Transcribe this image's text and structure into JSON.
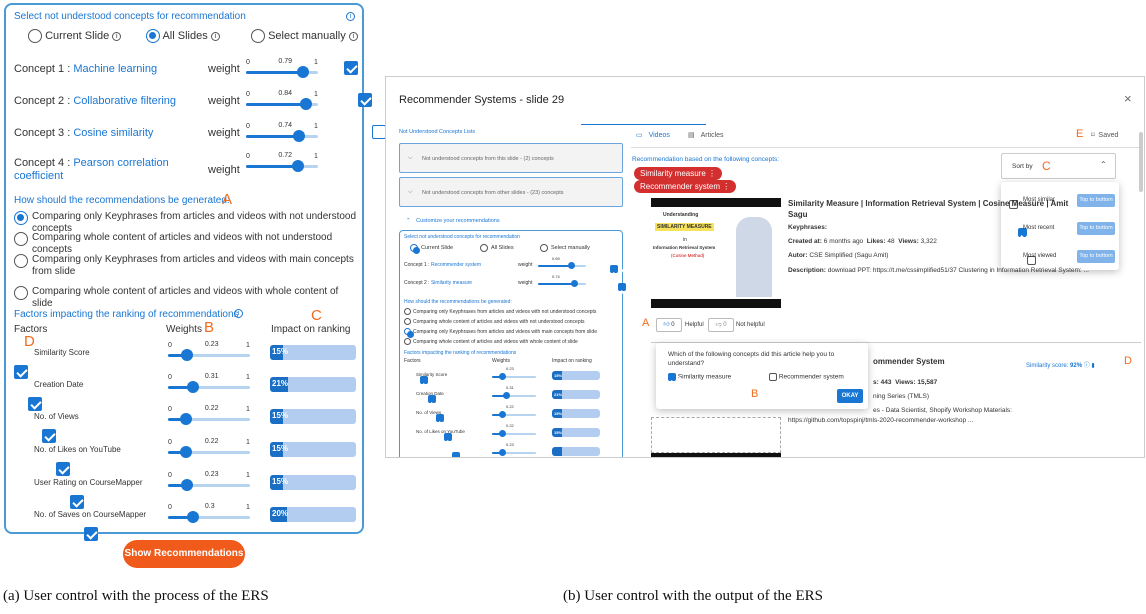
{
  "panelA": {
    "concept_heading": "Select not understood concepts for recommendation",
    "scope_options": [
      "Current Slide",
      "All Slides",
      "Select manually"
    ],
    "scope_selected": 1,
    "weight_label": "weight",
    "concepts": [
      {
        "prefix": "Concept 1 : ",
        "name": "Machine learning",
        "weight": "0.79",
        "value": 0.79,
        "checked": true
      },
      {
        "prefix": "Concept 2 : ",
        "name": "Collaborative filtering",
        "weight": "0.84",
        "value": 0.84,
        "checked": true
      },
      {
        "prefix": "Concept 3 : ",
        "name": "Cosine similarity",
        "weight": "0.74",
        "value": 0.74,
        "checked": false
      },
      {
        "prefix": "Concept 4 : ",
        "name": "Pearson correlation coefficient",
        "weight": "0.72",
        "value": 0.72,
        "checked": true
      }
    ],
    "range_min": "0",
    "range_max": "1",
    "generation_heading": "How should the recommendations be generated:",
    "generation_options": [
      "Comparing only Keyphrases from articles and videos with not understood concepts",
      "Comparing whole content of articles and videos with not understood concepts",
      "Comparing only Keyphrases from articles and videos with main concepts from slide",
      "Comparing whole content of articles and videos with whole content of slide"
    ],
    "generation_selected": 0,
    "factors_heading": "Factors impacting the ranking of recommendations",
    "col_factors": "Factors",
    "col_weights": "Weights",
    "col_impact": "Impact on ranking",
    "factors": [
      {
        "name": "Similarity Score",
        "weight": "0.23",
        "value": 0.23,
        "impact": "15%",
        "impact_value": 0.15
      },
      {
        "name": "Creation Date",
        "weight": "0.31",
        "value": 0.31,
        "impact": "21%",
        "impact_value": 0.21
      },
      {
        "name": "No. of Views",
        "weight": "0.22",
        "value": 0.22,
        "impact": "15%",
        "impact_value": 0.15
      },
      {
        "name": "No. of Likes on YouTube",
        "weight": "0.22",
        "value": 0.22,
        "impact": "15%",
        "impact_value": 0.15
      },
      {
        "name": "User Rating on CourseMapper",
        "weight": "0.23",
        "value": 0.23,
        "impact": "15%",
        "impact_value": 0.15
      },
      {
        "name": "No. of Saves on CourseMapper",
        "weight": "0.3",
        "value": 0.3,
        "impact": "20%",
        "impact_value": 0.2
      }
    ],
    "show_button": "Show Recommendations",
    "markers": {
      "A": "A",
      "B": "B",
      "C": "C",
      "D": "D"
    }
  },
  "panelB": {
    "title": "Recommender Systems - slide 29",
    "close": "×",
    "left_heading": "Not Understood Concepts Lists",
    "accordion1": "Not understood concepts from this slide - (2) concepts",
    "accordion2": "Not understood concepts from other slides - (23) concepts",
    "customize": "Customize your recommendations",
    "mini_heading": "Select not understood concepts for recommendation",
    "mini_scope": [
      "Current Slide",
      "All Slides",
      "Select manually"
    ],
    "mini_concepts": [
      {
        "prefix": "Concept 1 : ",
        "name": "Recommender system",
        "weight": "0.69"
      },
      {
        "prefix": "Concept 2 : ",
        "name": "Similarity measure",
        "weight": "0.74"
      }
    ],
    "mini_weight_label": "weight",
    "mini_generation_heading": "How should the recommendations be generated:",
    "mini_generation": [
      "Comparing only Keyphrases from articles and videos with not understood concepts",
      "Comparing whole content of articles and videos with not understood concepts",
      "Comparing only Keyphrases from articles and videos with main concepts from slide",
      "Comparing whole content of articles and videos with whole content of slide"
    ],
    "mini_factors_heading": "Factors impacting the ranking of recommendations",
    "mini_col_factors": "Factors",
    "mini_col_weights": "Weights",
    "mini_col_impact": "Impact on ranking",
    "mini_factors": [
      {
        "name": "Similarity Score",
        "weight": "0.23",
        "impact": "15%"
      },
      {
        "name": "Creation Date",
        "weight": "0.31",
        "impact": "21%"
      },
      {
        "name": "No. of Views",
        "weight": "0.22",
        "impact": "15%"
      },
      {
        "name": "No. of Likes on YouTube",
        "weight": "0.22",
        "impact": "15%"
      },
      {
        "name": "",
        "weight": "0.23",
        "impact": ""
      }
    ],
    "tabs": [
      "Videos",
      "Articles"
    ],
    "saved": "Saved",
    "based_on": "Recommendation based on the following concepts:",
    "concept_tags": [
      "Similarity measure",
      "Recommender system"
    ],
    "sort_by": "Sort by",
    "sort_options": [
      {
        "label": "Most similar",
        "checked": false
      },
      {
        "label": "Most recent",
        "checked": true
      },
      {
        "label": "Most viewed",
        "checked": false
      }
    ],
    "sort_button": "Top to bottom",
    "video1": {
      "title": "Similarity Measure | Information Retrieval System | Cosine Measure | Amit Sagu",
      "keyphrases": "Keyphrases:",
      "created_label": "Created at:",
      "created": "6 months ago",
      "likes_label": "Likes:",
      "likes": "48",
      "views_label": "Views:",
      "views": "3,322",
      "author_label": "Autor:",
      "author": "CSE Simplified (Sagu Amit)",
      "desc_label": "Description:",
      "desc": "download PPT: https://t.me/cssimplified51/37 Clustering in Information Retrieval System: ...",
      "thumb_lines": [
        "Understanding",
        "SIMILARITY MEASURE",
        "in",
        "Information Retrieval System",
        "(Cosine Method)"
      ]
    },
    "helpful": "Helpful",
    "not_helpful": "Not helpful",
    "helpful_count": "0",
    "not_helpful_count": "0",
    "video2": {
      "title_partial": "ommender System",
      "similarity_label": "Similarity score:",
      "similarity": "92%",
      "line1_partial": "s: 443",
      "views_label": "Views:",
      "views": "15,587",
      "line2_partial": "ning Series (TMLS)",
      "line3_partial": "es - Data Scientist, Shopify Workshop Materials:",
      "line4": "https://github.com/topspinj/tmls-2020-recommender-workshop ..."
    },
    "dialog_question": "Which of the following concepts did this article help you to understand?",
    "dialog_options": [
      {
        "label": "Similarity measure",
        "checked": true
      },
      {
        "label": "Recommender system",
        "checked": false
      }
    ],
    "dialog_ok": "OKAY",
    "markers": {
      "A": "A",
      "B": "B",
      "C": "C",
      "D": "D",
      "E": "E"
    }
  },
  "captions": {
    "a": "(a) User control with the process of the ERS",
    "b": "(b) User control with the output of the ERS"
  }
}
